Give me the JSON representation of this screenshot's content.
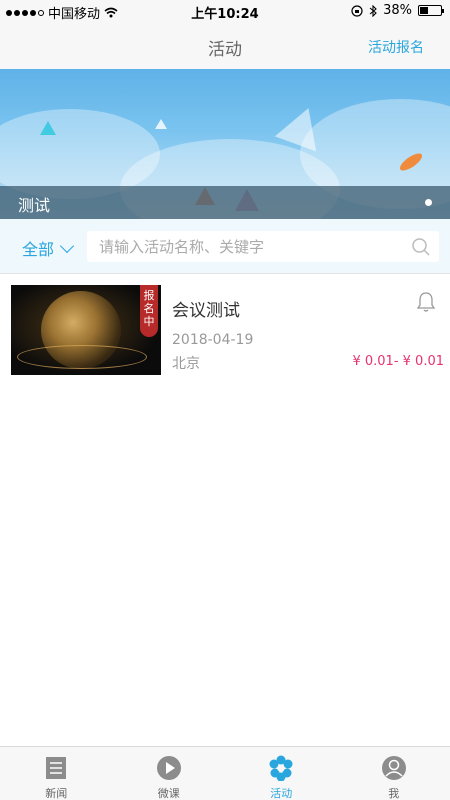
{
  "status_bar": {
    "carrier": "中国移动",
    "time": "上午10:24",
    "battery": "38%",
    "battery_level": 0.38
  },
  "nav": {
    "title": "活动",
    "action_label": "活动报名"
  },
  "banner": {
    "title": "测试"
  },
  "filter": {
    "selected": "全部",
    "search_placeholder": "请输入活动名称、关键字"
  },
  "activities": [
    {
      "badge": "报名中",
      "title": "会议测试",
      "date": "2018-04-19",
      "location": "北京",
      "price": "¥ 0.01- ¥ 0.01"
    }
  ],
  "tabs": [
    {
      "label": "新闻",
      "icon": "news-icon",
      "active": false
    },
    {
      "label": "微课",
      "icon": "play-icon",
      "active": false
    },
    {
      "label": "活动",
      "icon": "flower-icon",
      "active": true
    },
    {
      "label": "我",
      "icon": "profile-icon",
      "active": false
    }
  ],
  "colors": {
    "accent": "#2aa6de",
    "price": "#e5336d",
    "badge": "#b72a2a"
  }
}
